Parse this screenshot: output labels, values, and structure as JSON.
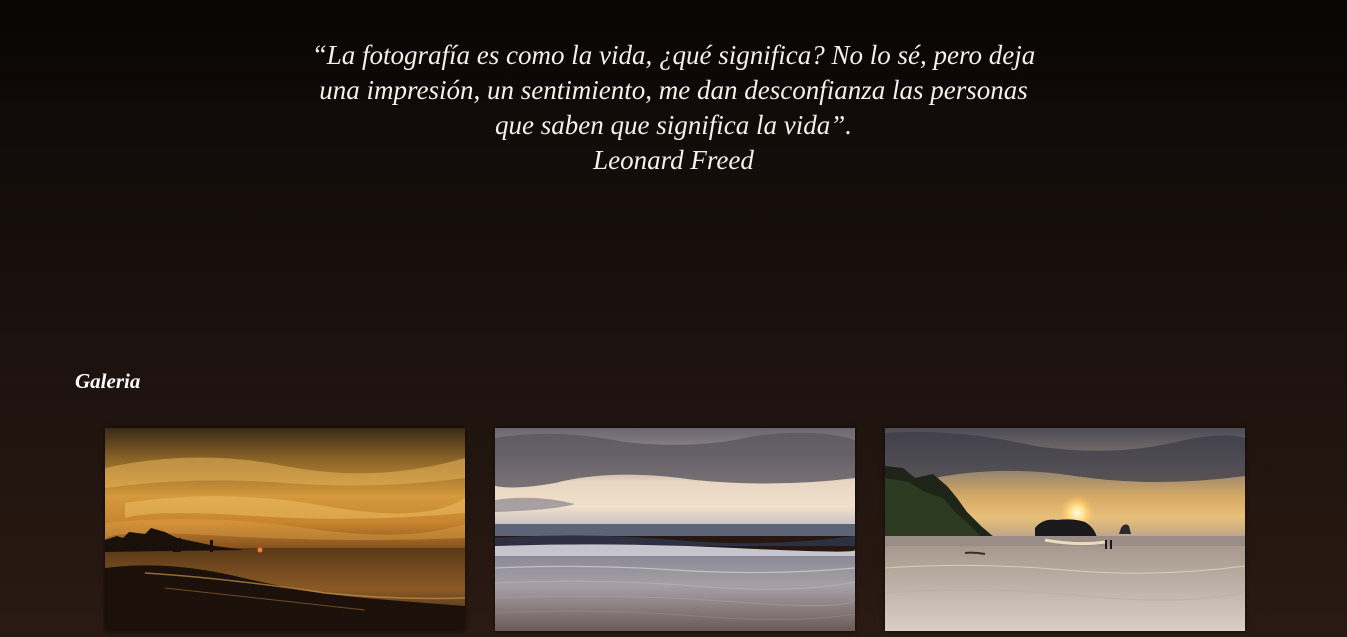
{
  "quote": {
    "line1": "“La fotografía es como la vida, ¿qué significa? No lo sé, pero deja",
    "line2": "una impresión, un sentimiento, me dan desconfianza las personas",
    "line3": "que saben que significa la vida”.",
    "author": "Leonard Freed"
  },
  "gallery": {
    "title": "Galeria",
    "photos": [
      {
        "name": "sunset-beach-golden-sky"
      },
      {
        "name": "beach-waves-cloudy-dusk"
      },
      {
        "name": "beach-cliffs-sunset-walkers"
      }
    ]
  },
  "colors": {
    "background_top": "#070505",
    "background_bottom": "#2a1a12",
    "text": "#f6f0e8"
  }
}
